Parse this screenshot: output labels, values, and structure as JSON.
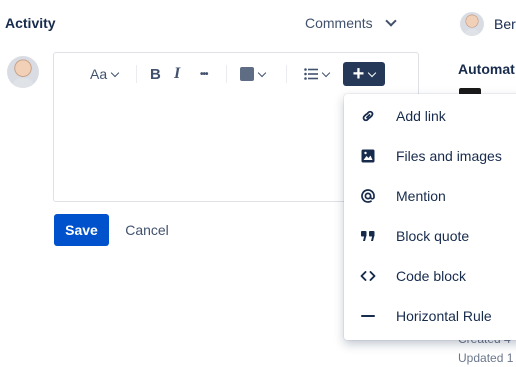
{
  "activity": {
    "title": "Activity"
  },
  "comments_filter": {
    "value": "Comments"
  },
  "sidebar": {
    "user_name": "Ber",
    "automation_title": "Automat",
    "created_text": "Created  4",
    "updated_text": "Updated 1"
  },
  "toolbar": {
    "text_style_label": "Aa",
    "bold_label": "B",
    "italic_label": "I",
    "more_label": "•••",
    "text_color": "#5e6c84",
    "insert_label": "+"
  },
  "actions": {
    "save_label": "Save",
    "cancel_label": "Cancel"
  },
  "insert_menu": {
    "items": [
      {
        "label": "Add link",
        "icon": "link-icon"
      },
      {
        "label": "Files and images",
        "icon": "image-icon"
      },
      {
        "label": "Mention",
        "icon": "at-icon"
      },
      {
        "label": "Block quote",
        "icon": "quote-icon"
      },
      {
        "label": "Code block",
        "icon": "code-icon"
      },
      {
        "label": "Horizontal Rule",
        "icon": "horizontal-rule-icon"
      }
    ]
  },
  "colors": {
    "primary": "#0052cc",
    "toolbar_active": "#253858",
    "text": "#172b4d",
    "subtle_text": "#42526e"
  }
}
